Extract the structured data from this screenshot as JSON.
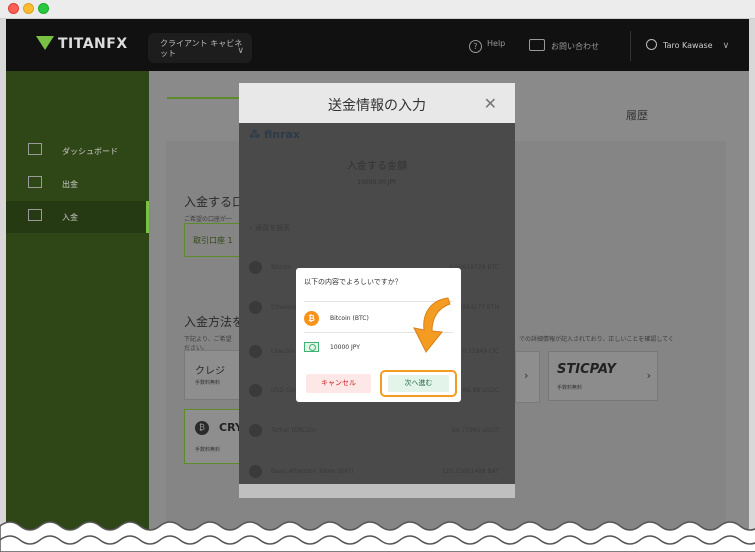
{
  "brand": {
    "logo": "TITANFX",
    "accent": "#79c143"
  },
  "header": {
    "client_selector": "クライアント キャビネット",
    "help": "Help",
    "contact": "お問い合わせ",
    "user": "Taro Kawase"
  },
  "sidebar": {
    "items": [
      {
        "label": "ダッシュボード",
        "icon": "bar-chart-icon"
      },
      {
        "label": "出金",
        "icon": "withdraw-icon"
      },
      {
        "label": "入金",
        "icon": "deposit-icon",
        "active": true
      }
    ]
  },
  "background": {
    "history_tab": "履歴",
    "deposit_title": "入金する口",
    "deposit_sub": "ご希望の口座が一",
    "account_box": "取引口座 1",
    "method_title": "入金方法を",
    "method_sub": "下記より、ご希望",
    "method_sub_right": "での詳細情報が記入されており、正しいことを確認してく",
    "method_sub_right2": "ださい。",
    "credit_label": "クレジ",
    "crypto_label": "CRY",
    "sticpay": "STICPAY",
    "sticpay_sub": "手数料無料",
    "sub_fee": "手数料無料"
  },
  "modal": {
    "title": "送金情報の入力",
    "provider": "finrax",
    "amount_title": "入金する金額",
    "amount_value": "10000.00 JPY",
    "search_placeholder": "通貨を検索",
    "coins": [
      {
        "name": "Bitcoin",
        "value": "0.00618729 BTC"
      },
      {
        "name": "Ethereum",
        "value": "0.0364177 ETH"
      },
      {
        "name": "Litecoin",
        "value": "0.72949 LTC"
      },
      {
        "name": "USD Coin",
        "value": "66.88 USDC"
      },
      {
        "name": "Tether (ERC20)",
        "value": "64.77991 USDT"
      },
      {
        "name": "Basic Attention Token (BAT)",
        "value": "120.25051488 BAT"
      }
    ]
  },
  "dialog": {
    "question": "以下の内容でよろしいですか？",
    "crypto": "Bitcoin (BTC)",
    "amount": "10000 JPY",
    "cancel": "キャンセル",
    "next": "次へ進む"
  }
}
